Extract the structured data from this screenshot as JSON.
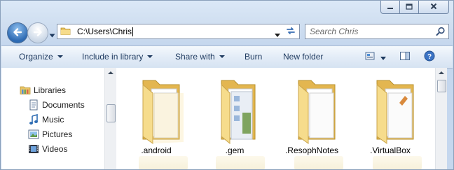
{
  "window": {
    "controls": {
      "minimize": "minimize-icon",
      "maximize": "maximize-icon",
      "close": "close-icon"
    }
  },
  "navigation": {
    "back_icon": "back-arrow-icon",
    "forward_icon": "forward-arrow-icon",
    "address_path": "C:\\Users\\Chris",
    "search_placeholder": "Search Chris"
  },
  "toolbar": {
    "organize": "Organize",
    "include_in_library": "Include in library",
    "share_with": "Share with",
    "burn": "Burn",
    "new_folder": "New folder",
    "view_icons": [
      "change-view-icon",
      "preview-pane-icon",
      "help-icon"
    ]
  },
  "sidebar": {
    "root": {
      "label": "Libraries",
      "icon": "libraries-icon"
    },
    "items": [
      {
        "label": "Documents",
        "icon": "documents-icon"
      },
      {
        "label": "Music",
        "icon": "music-icon"
      },
      {
        "label": "Pictures",
        "icon": "pictures-icon"
      },
      {
        "label": "Videos",
        "icon": "videos-icon"
      }
    ]
  },
  "files": [
    {
      "name": ".android",
      "icon": "folder-icon"
    },
    {
      "name": ".gem",
      "icon": "folder-icon"
    },
    {
      "name": ".ResophNotes",
      "icon": "folder-icon"
    },
    {
      "name": ".VirtualBox",
      "icon": "folder-icon"
    }
  ],
  "colors": {
    "accent": "#2d6ab3",
    "toolbar_text": "#1e3a5f",
    "folder": "#f2d480"
  }
}
